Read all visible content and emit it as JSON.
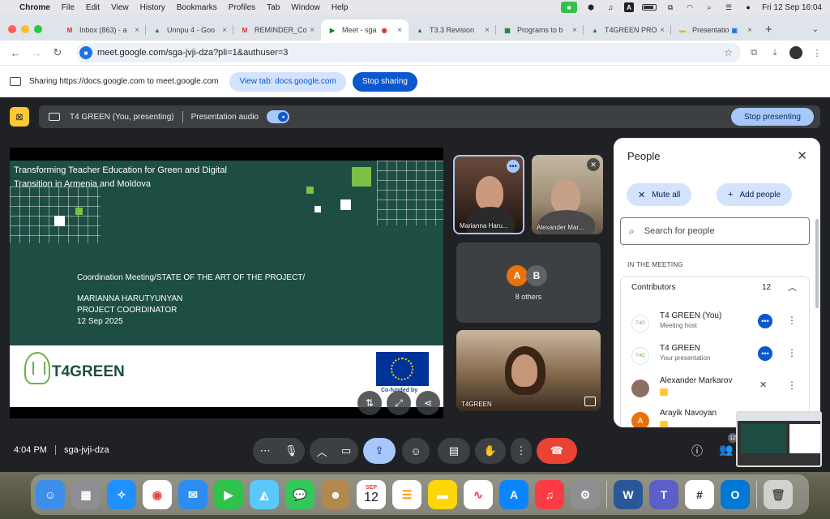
{
  "menubar": {
    "app": "Chrome",
    "items": [
      "File",
      "Edit",
      "View",
      "History",
      "Bookmarks",
      "Profiles",
      "Tab",
      "Window",
      "Help"
    ],
    "clock": "Fri 12 Sep  16:04"
  },
  "tabs": [
    {
      "label": "Inbox (863) - a",
      "icon": "gmail-icon",
      "color": "#d93025"
    },
    {
      "label": "Unnpu 4 - Goo",
      "icon": "drive-icon",
      "color": "#188038"
    },
    {
      "label": "REMINDER_Co",
      "icon": "gmail-icon",
      "color": "#d93025"
    },
    {
      "label": "Meet - sga",
      "icon": "meet-icon",
      "color": "#00832d",
      "active": true
    },
    {
      "label": "T3.3 Revision",
      "icon": "drive-icon",
      "color": "#188038"
    },
    {
      "label": "Programs to b",
      "icon": "sheets-icon",
      "color": "#188038"
    },
    {
      "label": "T4GREEN PRO",
      "icon": "drive-icon",
      "color": "#188038"
    },
    {
      "label": "Presentation",
      "icon": "slides-icon",
      "color": "#f4b400"
    }
  ],
  "toolbar": {
    "url": "meet.google.com/sga-jvji-dza?pli=1&authuser=3"
  },
  "sharebar": {
    "text": "Sharing https://docs.google.com to meet.google.com",
    "view_tab": "View tab: docs.google.com",
    "stop_sharing": "Stop sharing"
  },
  "present_bar": {
    "presenter": "T4 GREEN (You, presenting)",
    "audio": "Presentation audio",
    "stop": "Stop presenting"
  },
  "slide": {
    "title_line1": "Transforming Teacher Education for Green and Digital",
    "title_line2": "Transition in Armenia and Moldova",
    "meeting": "Coordination Meeting/STATE OF THE ART OF THE PROJECT/",
    "name": "MARIANNA HARUTYUNYAN",
    "role": "PROJECT COORDINATOR",
    "date": "12 Sep 2025",
    "logo_text": "T4GREEN",
    "eu_text": "Co-funded by"
  },
  "tiles": {
    "tile1": "Marianna Haru...",
    "tile2": "Alexander Mar...",
    "others": "8 others",
    "others_a": "A",
    "others_b": "B",
    "tile4": "T4GREEN"
  },
  "people": {
    "title": "People",
    "mute_all": "Mute all",
    "add_people": "Add people",
    "search_placeholder": "Search for people",
    "in_meeting": "IN THE MEETING",
    "contributors": "Contributors",
    "count": "12",
    "rows": [
      {
        "name": "T4 GREEN (You)",
        "sub": "Meeting host"
      },
      {
        "name": "T4 GREEN",
        "sub": "Your presentation"
      },
      {
        "name": "Alexander Markarov",
        "sub": ""
      },
      {
        "name": "Arayik Navoyan",
        "sub": "",
        "initial": "A"
      }
    ]
  },
  "bottom": {
    "time": "4:04 PM",
    "code": "sga-jvji-dza",
    "people_count": "12"
  },
  "dock": {
    "calendar_month": "SEP",
    "calendar_day": "12"
  }
}
